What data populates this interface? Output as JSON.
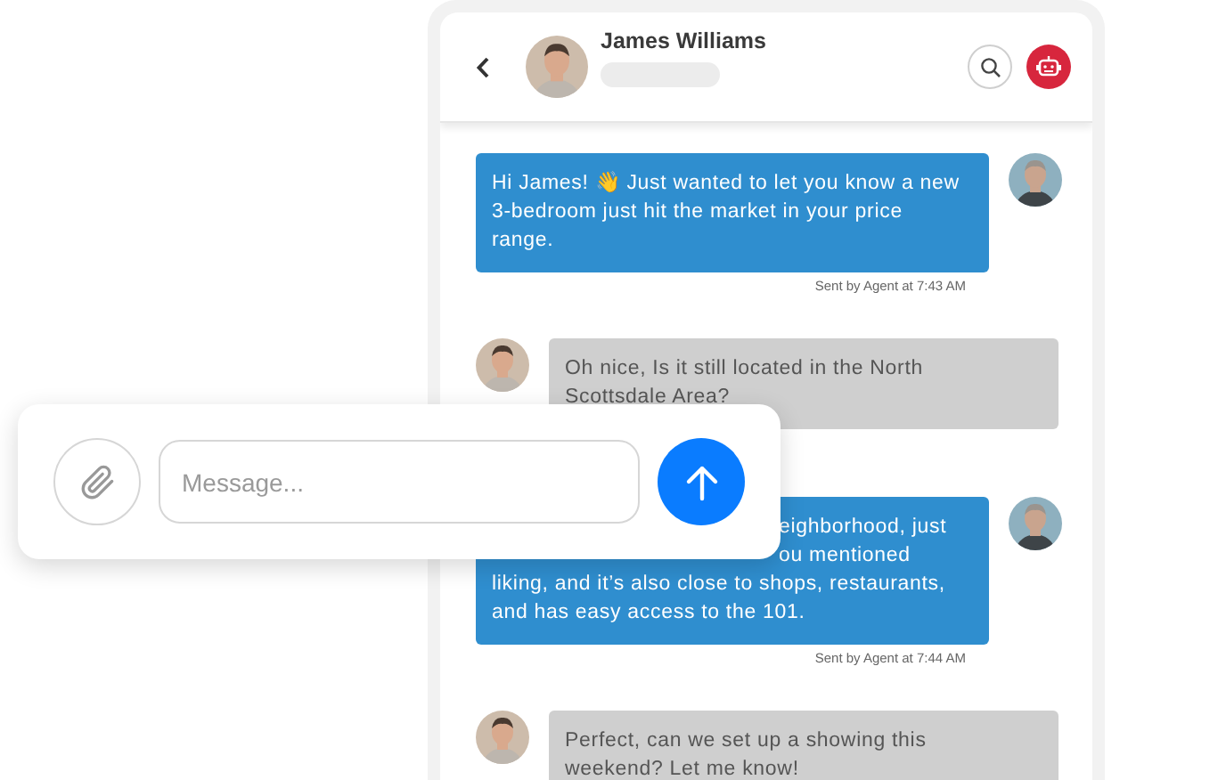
{
  "contact": {
    "name": "James Williams"
  },
  "messages": [
    {
      "kind": "sent",
      "text": "Hi James! 👋 Just wanted to let you know a new 3-bedroom just hit the market in your price range.",
      "timestamp": "Sent by Agent at 7:43 AM"
    },
    {
      "kind": "received",
      "text": "Oh nice, Is it still located in the North Scottsdale Area?"
    },
    {
      "kind": "sent",
      "lines": [
        {
          "text": "eighborhood, just",
          "partial": true
        },
        {
          "text": "ou mentioned",
          "partial": true
        },
        {
          "text": "liking, and it’s also close to shops, restaurants,",
          "partial": false
        },
        {
          "text": "and has easy access to the 101.",
          "partial": false
        }
      ],
      "timestamp": "Sent by Agent at 7:44 AM"
    },
    {
      "kind": "received",
      "text": "Perfect, can we set up a showing this weekend? Let me know!"
    }
  ],
  "composer": {
    "placeholder": "Message..."
  }
}
